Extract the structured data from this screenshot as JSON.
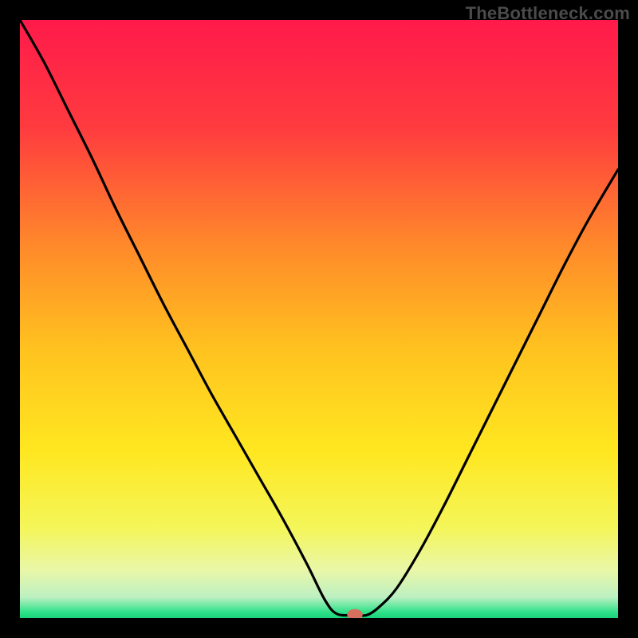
{
  "watermark": "TheBottleneck.com",
  "chart_data": {
    "type": "line",
    "title": "",
    "xlabel": "",
    "ylabel": "",
    "xlim": [
      0,
      100
    ],
    "ylim": [
      0,
      100
    ],
    "grid": false,
    "legend": false,
    "background_gradient": {
      "stops": [
        {
          "pos": 0.0,
          "color": "#ff1a4b"
        },
        {
          "pos": 0.18,
          "color": "#ff3b3f"
        },
        {
          "pos": 0.38,
          "color": "#ff8a2a"
        },
        {
          "pos": 0.55,
          "color": "#ffc21f"
        },
        {
          "pos": 0.72,
          "color": "#ffe720"
        },
        {
          "pos": 0.85,
          "color": "#f4f65a"
        },
        {
          "pos": 0.92,
          "color": "#e9f7a8"
        },
        {
          "pos": 0.965,
          "color": "#bdf0c2"
        },
        {
          "pos": 0.99,
          "color": "#2fe28a"
        },
        {
          "pos": 1.0,
          "color": "#18d37b"
        }
      ]
    },
    "series": [
      {
        "name": "bottleneck-curve",
        "x": [
          0.0,
          4.0,
          8.0,
          12.0,
          16.0,
          20.0,
          24.0,
          28.0,
          32.0,
          36.0,
          40.0,
          44.0,
          48.0,
          51.0,
          53.0,
          56.0,
          58.0,
          60.0,
          63.0,
          67.0,
          71.0,
          75.0,
          79.0,
          83.0,
          87.0,
          91.0,
          95.0,
          100.0
        ],
        "y": [
          100.0,
          93.0,
          85.0,
          77.0,
          68.5,
          60.5,
          52.5,
          45.0,
          37.5,
          30.5,
          23.5,
          16.5,
          9.0,
          3.0,
          0.7,
          0.5,
          0.5,
          1.8,
          5.0,
          11.5,
          19.0,
          27.0,
          35.0,
          43.0,
          51.0,
          59.0,
          66.5,
          75.0
        ]
      }
    ],
    "marker": {
      "name": "optimal-point",
      "x": 56.0,
      "y": 0.6,
      "rx": 1.3,
      "ry": 0.9,
      "color": "#d6705e"
    }
  }
}
